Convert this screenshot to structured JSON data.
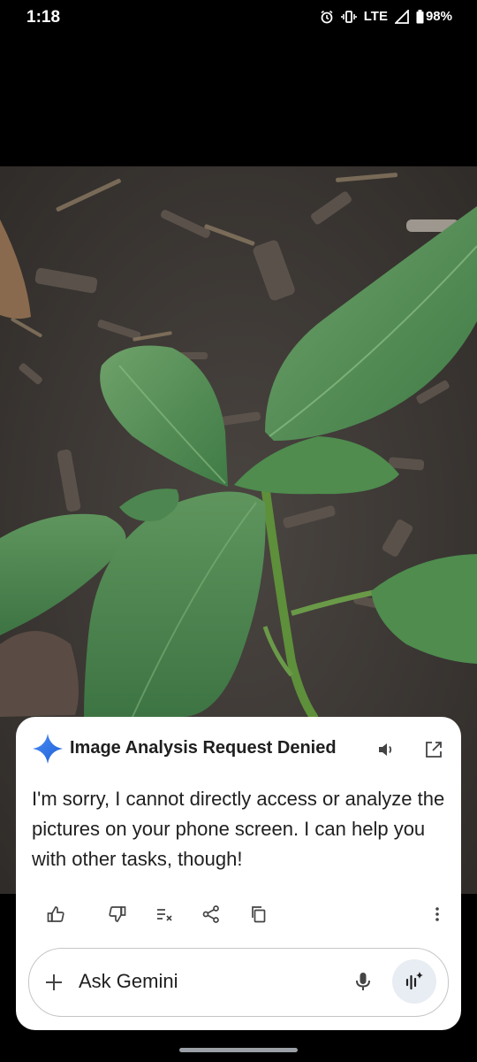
{
  "status": {
    "time": "1:18",
    "network": "LTE",
    "battery": "98%"
  },
  "card": {
    "title": "Image Analysis Request Denied",
    "message": "I'm sorry, I cannot directly access or analyze the pictures on your phone screen. I can help you with other tasks, though!",
    "accent": "#4285F4"
  },
  "input": {
    "placeholder": "Ask Gemini"
  }
}
